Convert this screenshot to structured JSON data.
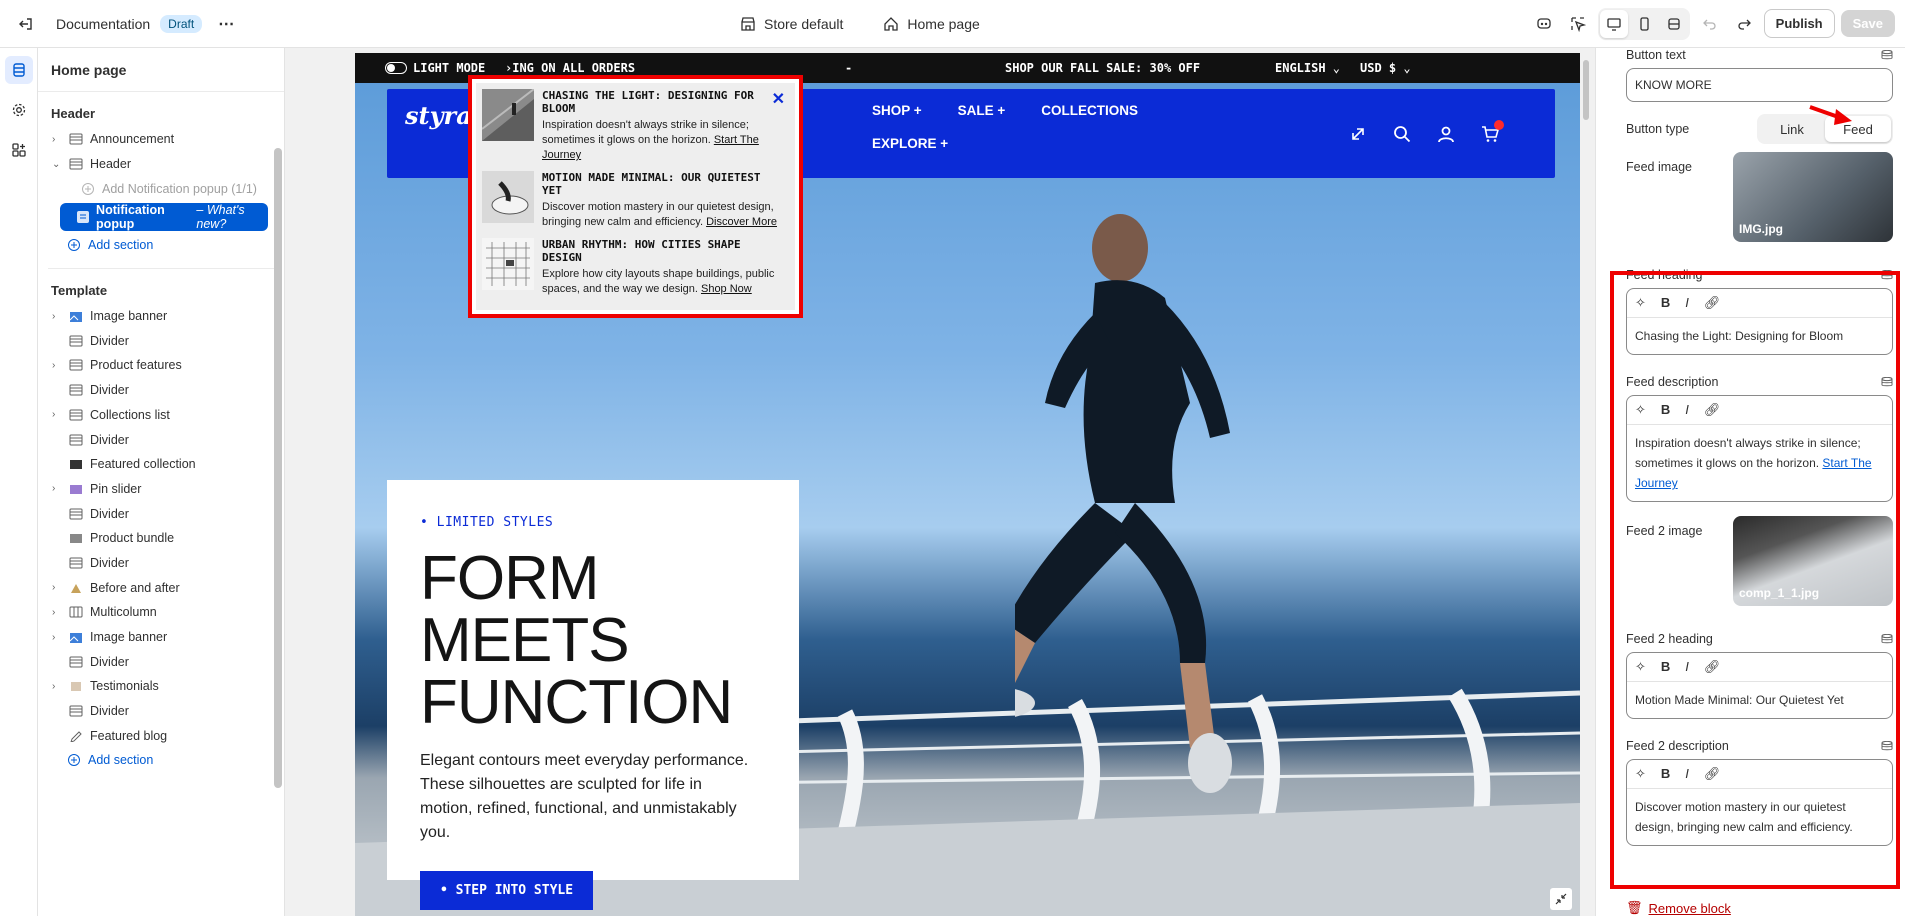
{
  "topbar": {
    "title": "Documentation",
    "badge": "Draft",
    "store": "Store default",
    "page": "Home page",
    "publish": "Publish",
    "save": "Save"
  },
  "sidebar": {
    "title": "Home page",
    "header_group": "Header",
    "header_items": [
      {
        "label": "Announcement"
      },
      {
        "label": "Header"
      }
    ],
    "add_popup": "Add Notification popup (1/1)",
    "selected_label": "Notification popup",
    "selected_suffix": "– What's new?",
    "add_section": "Add section",
    "template_group": "Template",
    "template_items": [
      {
        "label": "Image banner",
        "chev": true
      },
      {
        "label": "Divider",
        "chev": false
      },
      {
        "label": "Product features",
        "chev": true
      },
      {
        "label": "Divider",
        "chev": false
      },
      {
        "label": "Collections list",
        "chev": true
      },
      {
        "label": "Divider",
        "chev": false
      },
      {
        "label": "Featured collection",
        "chev": false
      },
      {
        "label": "Pin slider",
        "chev": true
      },
      {
        "label": "Divider",
        "chev": false
      },
      {
        "label": "Product bundle",
        "chev": false
      },
      {
        "label": "Divider",
        "chev": false
      },
      {
        "label": "Before and after",
        "chev": true
      },
      {
        "label": "Multicolumn",
        "chev": true
      },
      {
        "label": "Image banner",
        "chev": true
      },
      {
        "label": "Divider",
        "chev": false
      },
      {
        "label": "Testimonials",
        "chev": true
      },
      {
        "label": "Divider",
        "chev": false
      },
      {
        "label": "Featured blog",
        "chev": false
      }
    ],
    "add_section_2": "Add section"
  },
  "preview": {
    "announce": {
      "light_mode": "LIGHT MODE",
      "scroll_text": "›ING ON ALL ORDERS",
      "dash": "-",
      "sale": "SHOP OUR FALL SALE: 30% OFF",
      "lang": "ENGLISH",
      "currency": "USD $"
    },
    "logo": "styra",
    "menu": [
      "SHOP +",
      "SALE +",
      "COLLECTIONS",
      "EXPLORE +"
    ],
    "hero": {
      "eyebrow": "• LIMITED STYLES",
      "heading_1": "FORM MEETS",
      "heading_2": "FUNCTION",
      "text": "Elegant contours meet everyday performance. These silhouettes are sculpted for life in motion, refined, functional, and unmistakably you.",
      "button": "• STEP INTO STYLE"
    },
    "popup": {
      "feeds": [
        {
          "heading": "CHASING THE LIGHT: DESIGNING FOR BLOOM",
          "text": "Inspiration doesn't always strike in silence; sometimes it glows on the horizon. ",
          "link": "Start The Journey"
        },
        {
          "heading": "MOTION MADE MINIMAL: OUR QUIETEST YET",
          "text": "Discover motion mastery in our quietest design, bringing new calm and efficiency. ",
          "link": "Discover More"
        },
        {
          "heading": "URBAN RHYTHM: HOW CITIES SHAPE DESIGN",
          "text": "Explore how city layouts shape buildings, public spaces, and the way we design. ",
          "link": "Shop Now"
        }
      ]
    }
  },
  "panel": {
    "button_text_label": "Button text",
    "button_text_value": "KNOW MORE",
    "button_type_label": "Button type",
    "type_options": [
      "Link",
      "Feed"
    ],
    "type_selected": "Feed",
    "feed_image_label": "Feed image",
    "feed_image_file": "IMG.jpg",
    "feed_heading_label": "Feed heading",
    "feed_heading_value": "Chasing the Light: Designing for Bloom",
    "feed_desc_label": "Feed description",
    "feed_desc_value": "Inspiration doesn't always strike in silence; sometimes it glows on the horizon. ",
    "feed_desc_link": "Start The Journey",
    "feed2_image_label": "Feed 2 image",
    "feed2_image_file": "comp_1_1.jpg",
    "feed2_heading_label": "Feed 2 heading",
    "feed2_heading_value": "Motion Made Minimal: Our Quietest Yet",
    "feed2_desc_label": "Feed 2 description",
    "feed2_desc_value": "Discover motion mastery in our quietest design, bringing new calm and efficiency.",
    "remove_block": "Remove block"
  },
  "colors": {
    "brand_blue": "#0b2bd6",
    "admin_blue": "#005bd3",
    "highlight_red": "#ee0000"
  }
}
